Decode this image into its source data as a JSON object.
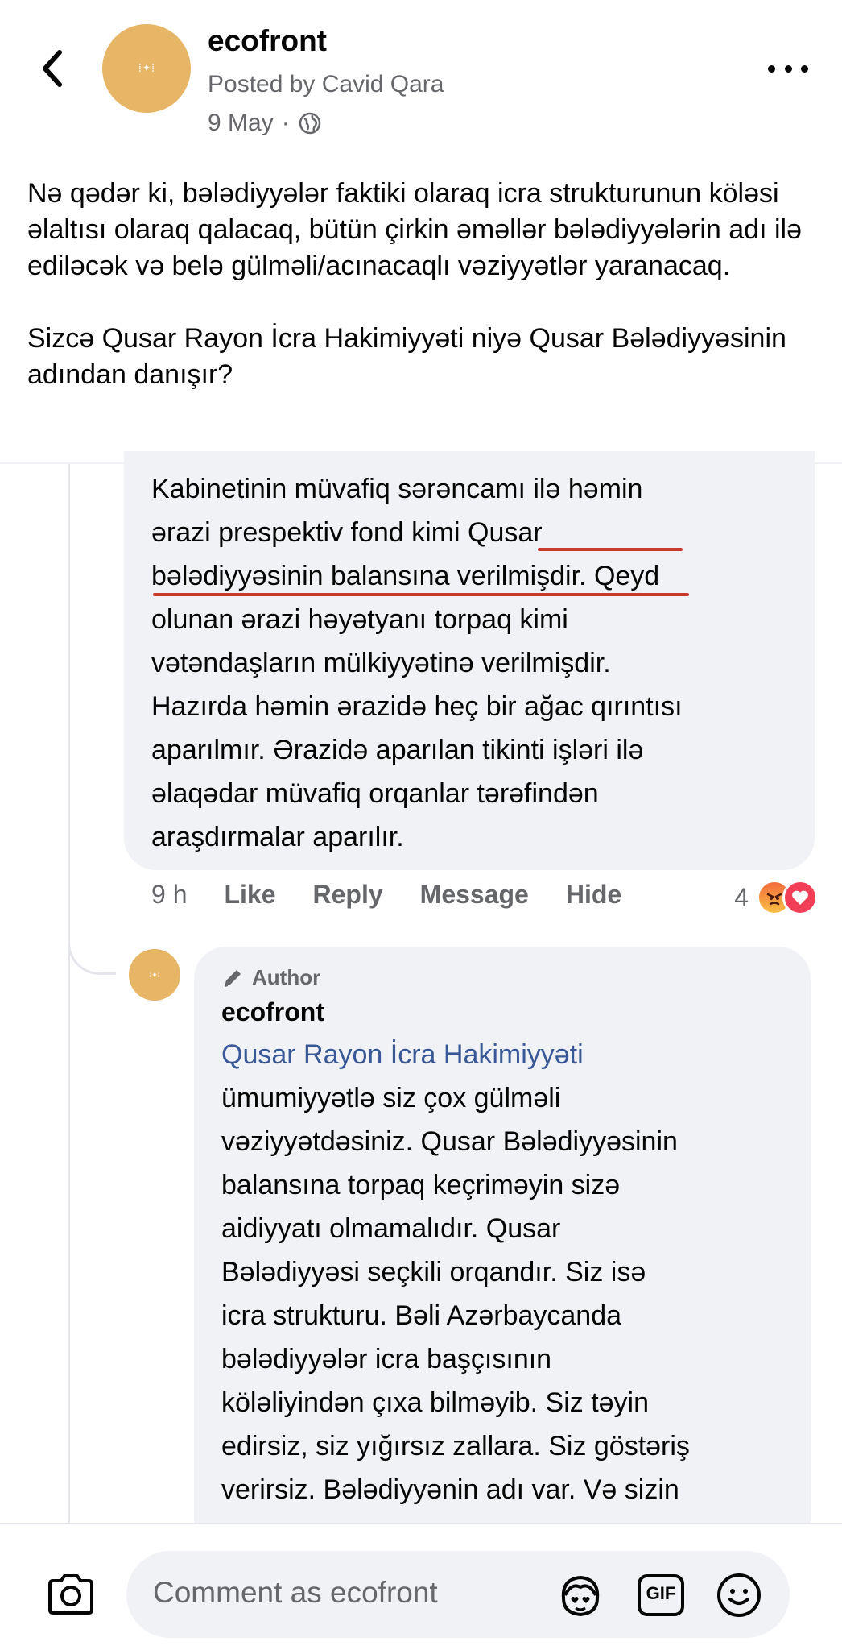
{
  "header": {
    "page_name": "ecofront",
    "posted_by": "Posted by Cavid Qara",
    "date": "9 May",
    "separator": "·"
  },
  "post": {
    "paragraphs": [
      "Nə qədər ki, bələdiyyələr faktiki olaraq icra strukturunun köləsi əlaltısı olaraq qalacaq, bütün çirkin əməllər bələdiyyələrin adı ilə ediləcək və belə gülməli/acınacaqlı vəziyyətlər yaranacaq.",
      "Sizcə Qusar Rayon İcra Hakimiyyəti  niyə Qusar Bələdiyyəsinin adından danışır?"
    ]
  },
  "comment": {
    "lines": [
      "Kabinetinin müvafiq sərəncamı ilə həmin",
      "ərazi prespektiv fond kimi Qusar",
      "bələdiyyəsinin balansına verilmişdir. Qeyd",
      "olunan ərazi həyətyanı torpaq kimi",
      "vətəndaşların mülkiyyətinə verilmişdir.",
      "Hazırda həmin ərazidə heç bir ağac qırıntısı",
      "aparılmır. Ərazidə aparılan tikinti işləri ilə",
      "əlaqədar müvafiq orqanlar tərəfindən",
      "araşdırmalar aparılır."
    ],
    "time": "9 h",
    "like": "Like",
    "reply": "Reply",
    "message": "Message",
    "hide": "Hide",
    "reaction_count": "4"
  },
  "reply": {
    "badge": "Author",
    "name": "ecofront",
    "mention": "Qusar Rayon İcra Hakimiyyəti",
    "lines": [
      "ümumiyyətlə siz çox gülməli",
      "vəziyyətdəsiniz. Qusar Bələdiyyəsinin",
      "balansına torpaq keçriməyin sizə",
      "aidiyyatı olmamalıdır. Qusar",
      "Bələdiyyəsi seçkili orqandır. Siz isə",
      "icra strukturu. Bəli Azərbaycanda",
      "bələdiyyələr icra başçısının",
      "köləliyindən çıxa bilməyib. Siz təyin",
      "edirsiz, siz yığırsız zallara. Siz göstəriş",
      "verirsiz. Bələdiyyənin adı var. Və sizin"
    ]
  },
  "composer": {
    "placeholder": "Comment as ecofront",
    "gif_label": "GIF"
  },
  "colors": {
    "link": "#385898",
    "underline": "#c73a2c",
    "avatar": "#e6b566",
    "bubble": "#f0f2f5"
  }
}
